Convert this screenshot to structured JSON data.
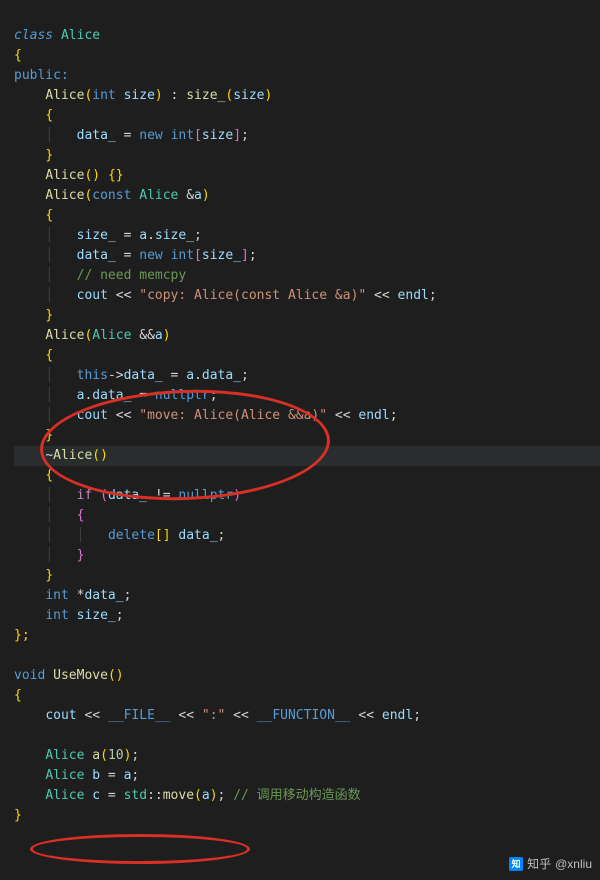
{
  "code": {
    "l1_class": "class",
    "l1_name": "Alice",
    "l2": "{",
    "l3": "public:",
    "l4_a": "Alice",
    "l4_b": "int",
    "l4_c": "size",
    "l4_d": "size_",
    "l4_e": "size",
    "l5": "{",
    "l6_a": "data_",
    "l6_b": "new",
    "l6_c": "int",
    "l6_d": "size",
    "l7": "}",
    "l8_a": "Alice",
    "l9_a": "Alice",
    "l9_b": "const",
    "l9_c": "Alice",
    "l9_d": "&",
    "l9_e": "a",
    "l10": "{",
    "l11_a": "size_",
    "l11_b": "a",
    "l11_c": "size_",
    "l12_a": "data_",
    "l12_b": "new",
    "l12_c": "int",
    "l12_d": "size_",
    "l13": "// need memcpy",
    "l14_a": "cout",
    "l14_b": "\"copy: Alice(const Alice &a)\"",
    "l14_c": "endl",
    "l15": "}",
    "l16_a": "Alice",
    "l16_b": "Alice",
    "l16_c": "&&",
    "l16_d": "a",
    "l17": "{",
    "l18_a": "this",
    "l18_b": "data_",
    "l18_c": "a",
    "l18_d": "data_",
    "l19_a": "a",
    "l19_b": "data_",
    "l19_c": "nullptr",
    "l20_a": "cout",
    "l20_b": "\"move: Alice(Alice &&a)\"",
    "l20_c": "endl",
    "l21": "}",
    "l22_a": "~",
    "l22_b": "Alice",
    "l23": "{",
    "l24_a": "if",
    "l24_b": "data_",
    "l24_c": "nullptr",
    "l25": "{",
    "l26_a": "delete",
    "l26_b": "data_",
    "l27": "}",
    "l28": "}",
    "l29_a": "int",
    "l29_b": "*",
    "l29_c": "data_",
    "l30_a": "int",
    "l30_b": "size_",
    "l31": "};",
    "l33_a": "void",
    "l33_b": "UseMove",
    "l34": "{",
    "l35_a": "cout",
    "l35_b": "__FILE__",
    "l35_c": "\":\"",
    "l35_d": "__FUNCTION__",
    "l35_e": "endl",
    "l37_a": "Alice",
    "l37_b": "a",
    "l37_c": "10",
    "l38_a": "Alice",
    "l38_b": "b",
    "l38_c": "a",
    "l39_a": "Alice",
    "l39_b": "c",
    "l39_c": "std",
    "l39_d": "move",
    "l39_e": "a",
    "l39_f": "// 调用移动构造函数",
    "l40": "}"
  },
  "watermark": {
    "brand": "知乎",
    "handle": "@xnliu",
    "icon_char": "知"
  }
}
